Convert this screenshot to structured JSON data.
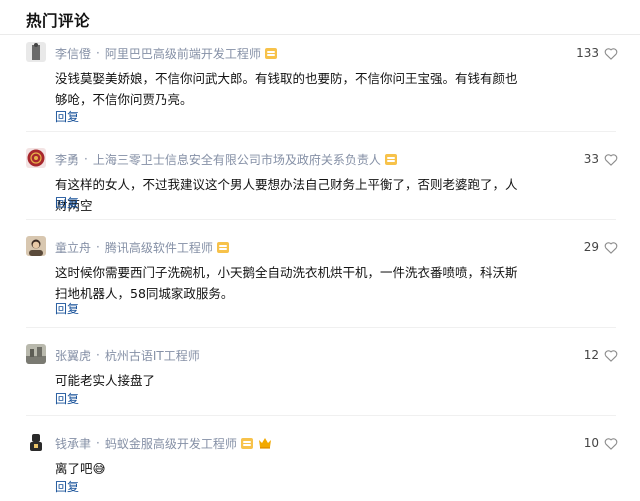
{
  "section": {
    "title": "热门评论"
  },
  "comments": [
    {
      "author": "李信僜",
      "headline": "阿里巴巴高级前端开发工程师",
      "badge": true,
      "crown": false,
      "content": "没钱莫娶美娇娘，不信你问武大郎。有钱取的也要防，不信你问王宝强。有钱有颜也够呛，不信你问贾乃亮。",
      "reply_label": "回复",
      "likes": "133",
      "avatar_color": "#6b6b6b"
    },
    {
      "author": "李勇",
      "headline": "上海三零卫士信息安全有限公司市场及政府关系负责人",
      "badge": true,
      "crown": false,
      "content": "有这样的女人，不过我建议这个男人要想办法自己财务上平衡了，否则老婆跑了，人财两空",
      "reply_label": "回复",
      "likes": "33",
      "avatar_color": "#a8272d"
    },
    {
      "author": "童立舟",
      "headline": "腾讯高级软件工程师",
      "badge": true,
      "crown": false,
      "content": "这时候你需要西门子洗碗机，小天鹅全自动洗衣机烘干机，一件洗衣番喷喷，科沃斯扫地机器人，58同城家政服务。",
      "reply_label": "回复",
      "likes": "29",
      "avatar_color": "#c89a6a"
    },
    {
      "author": "张翼虎",
      "headline": "杭州古语IT工程师",
      "badge": false,
      "crown": false,
      "content": "可能老实人接盘了",
      "reply_label": "回复",
      "likes": "12",
      "avatar_color": "#7a7a72"
    },
    {
      "author": "钱承聿",
      "headline": "蚂蚁金服高级开发工程师",
      "badge": true,
      "crown": true,
      "content": "离了吧😅",
      "reply_label": "回复",
      "likes": "10",
      "avatar_color": "#2a2a2a"
    }
  ],
  "colors": {
    "meta": "#8590a6",
    "link": "#175199",
    "text": "#121212",
    "badge": "#f7c24a"
  }
}
